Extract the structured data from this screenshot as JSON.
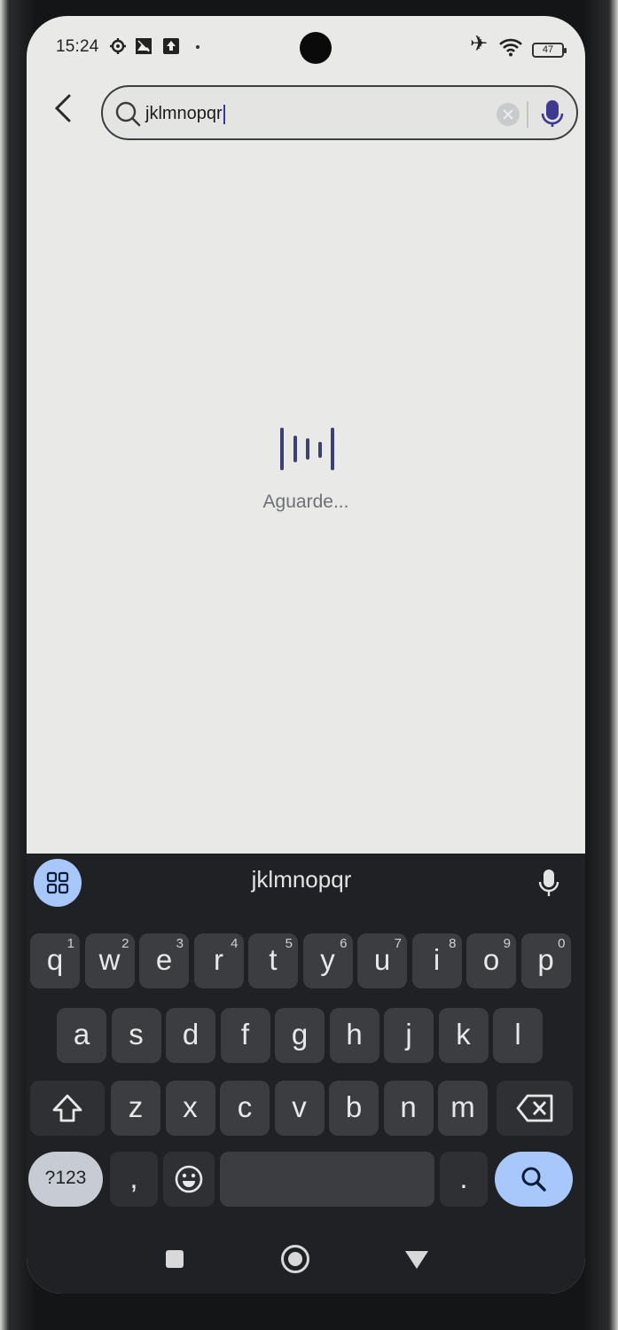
{
  "status_bar": {
    "time": "15:24",
    "battery": "47"
  },
  "search": {
    "query": "jklmnopqr"
  },
  "loading": {
    "message": "Aguarde..."
  },
  "keyboard": {
    "suggestion": "jklmnopqr",
    "row1": [
      {
        "k": "q",
        "n": "1"
      },
      {
        "k": "w",
        "n": "2"
      },
      {
        "k": "e",
        "n": "3"
      },
      {
        "k": "r",
        "n": "4"
      },
      {
        "k": "t",
        "n": "5"
      },
      {
        "k": "y",
        "n": "6"
      },
      {
        "k": "u",
        "n": "7"
      },
      {
        "k": "i",
        "n": "8"
      },
      {
        "k": "o",
        "n": "9"
      },
      {
        "k": "p",
        "n": "0"
      }
    ],
    "row2": [
      "a",
      "s",
      "d",
      "f",
      "g",
      "h",
      "j",
      "k",
      "l"
    ],
    "row3": [
      "z",
      "x",
      "c",
      "v",
      "b",
      "n",
      "m"
    ],
    "symbols_label": "?123",
    "comma": ",",
    "period": "."
  },
  "icons": [
    "back-arrow-icon",
    "search-icon",
    "clear-icon",
    "mic-icon",
    "apps-grid-icon",
    "shift-icon",
    "backspace-icon",
    "emoji-icon",
    "search-action-icon",
    "recents-icon",
    "home-icon",
    "back-nav-icon",
    "airplane-icon",
    "wifi-icon",
    "battery-icon"
  ],
  "colors": {
    "accent_blue": "#a8c7fa",
    "keyboard_bg": "#202124",
    "key_bg": "#3c3d40",
    "loader": "#3d4072"
  }
}
